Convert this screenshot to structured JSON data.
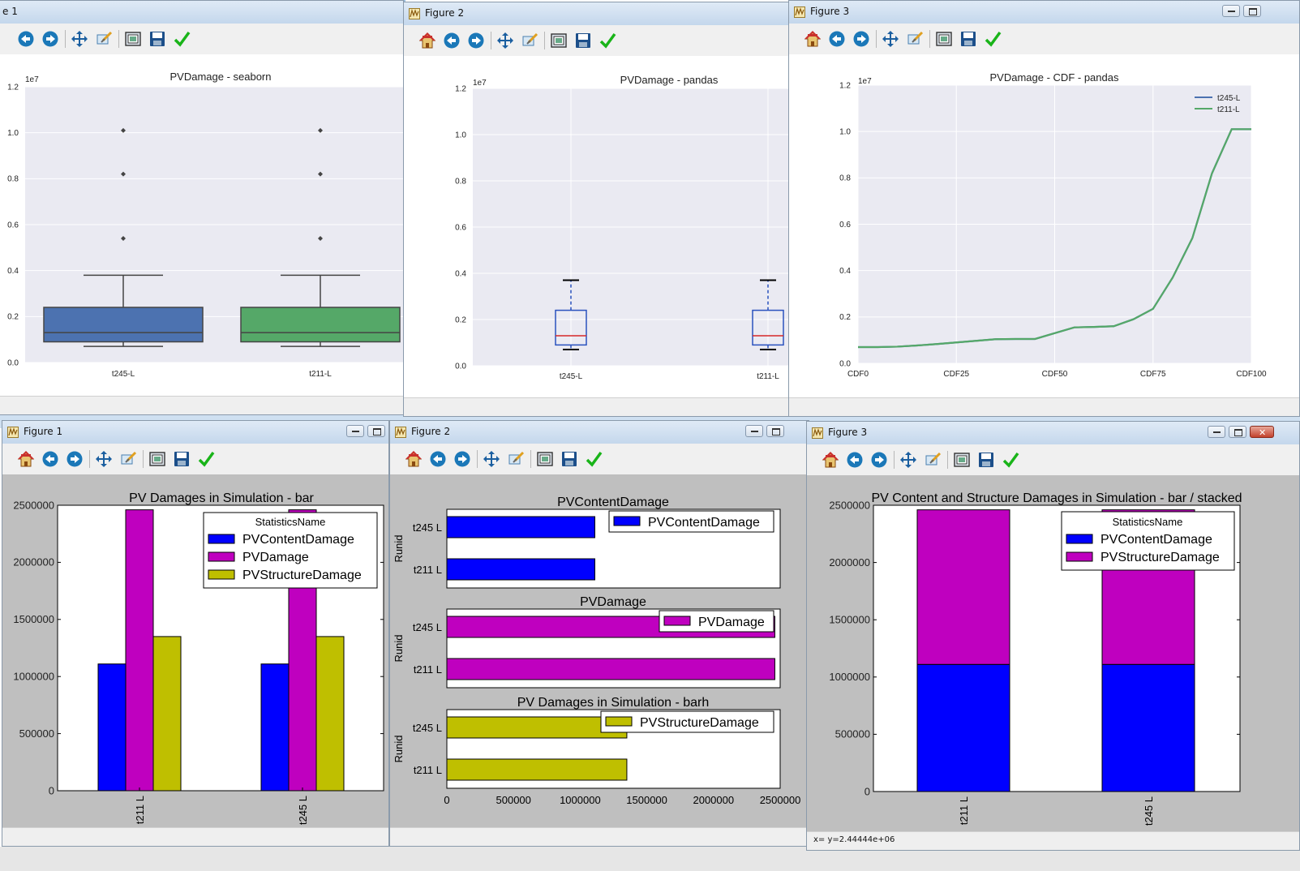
{
  "windows": [
    {
      "id": "w1",
      "title": "e 1",
      "controls": false
    },
    {
      "id": "w2",
      "title": "Figure 2",
      "controls": false
    },
    {
      "id": "w3",
      "title": "Figure 3",
      "controls": true
    },
    {
      "id": "w4",
      "title": "Figure 1",
      "controls": true
    },
    {
      "id": "w5",
      "title": "Figure 2",
      "controls": true
    },
    {
      "id": "w6",
      "title": "Figure 3",
      "controls": true,
      "close": true
    }
  ],
  "toolbar_icons": [
    "home-icon",
    "back-arrow-icon",
    "forward-arrow-icon",
    "pan-icon",
    "zoom-icon",
    "subplots-icon",
    "save-icon",
    "check-icon"
  ],
  "status": {
    "w6": "x= y=2.44444e+06"
  },
  "colors": {
    "seaborn_bg": "#eaeaf2",
    "seaborn_blue": "#4c72b0",
    "seaborn_green": "#55a868",
    "mpl_blue": "#0000ff",
    "mpl_magenta": "#bf00bf",
    "mpl_olive": "#bfbf00",
    "median_red": "#d62728",
    "gray_fig": "#bfbfbf"
  },
  "chart_data": [
    {
      "id": "c1",
      "type": "box",
      "title": "PVDamage - seaborn",
      "offset_text": "1e7",
      "ylim": [
        0,
        1.2
      ],
      "yticks": [
        "0.0",
        "0.2",
        "0.4",
        "0.6",
        "0.8",
        "1.0",
        "1.2"
      ],
      "categories": [
        "t245-L",
        "t211-L"
      ],
      "boxes": [
        {
          "name": "t245-L",
          "whislo": 0.07,
          "q1": 0.09,
          "med": 0.13,
          "q3": 0.24,
          "whishi": 0.38,
          "fliers": [
            0.54,
            0.82,
            1.01
          ]
        },
        {
          "name": "t211-L",
          "whislo": 0.07,
          "q1": 0.09,
          "med": 0.13,
          "q3": 0.24,
          "whishi": 0.38,
          "fliers": [
            0.54,
            0.82,
            1.01
          ]
        }
      ]
    },
    {
      "id": "c2",
      "type": "box",
      "title": "PVDamage - pandas",
      "offset_text": "1e7",
      "ylim": [
        0,
        1.2
      ],
      "yticks": [
        "0.0",
        "0.2",
        "0.4",
        "0.6",
        "0.8",
        "1.0",
        "1.2"
      ],
      "categories": [
        "t245-L",
        "t211-L"
      ],
      "boxes": [
        {
          "name": "t245-L",
          "whislo": 0.07,
          "q1": 0.09,
          "med": 0.13,
          "q3": 0.24,
          "whishi": 0.37
        },
        {
          "name": "t211-L",
          "whislo": 0.07,
          "q1": 0.09,
          "med": 0.13,
          "q3": 0.24,
          "whishi": 0.37
        }
      ]
    },
    {
      "id": "c3",
      "type": "line",
      "title": "PVDamage - CDF - pandas",
      "offset_text": "1e7",
      "ylim": [
        0,
        1.2
      ],
      "yticks": [
        "0.0",
        "0.2",
        "0.4",
        "0.6",
        "0.8",
        "1.0",
        "1.2"
      ],
      "xticks": [
        "CDF0",
        "CDF25",
        "CDF50",
        "CDF75",
        "CDF100"
      ],
      "x": [
        0,
        5,
        10,
        15,
        20,
        25,
        30,
        35,
        40,
        45,
        50,
        55,
        60,
        65,
        70,
        75,
        80,
        85,
        90,
        95,
        100
      ],
      "series": [
        {
          "name": "t245-L",
          "values": [
            0.07,
            0.07,
            0.072,
            0.077,
            0.083,
            0.09,
            0.097,
            0.104,
            0.105,
            0.105,
            0.13,
            0.155,
            0.157,
            0.16,
            0.19,
            0.235,
            0.37,
            0.54,
            0.82,
            1.01,
            1.01
          ]
        },
        {
          "name": "t211-L",
          "values": [
            0.07,
            0.07,
            0.072,
            0.077,
            0.083,
            0.09,
            0.097,
            0.104,
            0.105,
            0.105,
            0.13,
            0.155,
            0.157,
            0.16,
            0.19,
            0.235,
            0.37,
            0.54,
            0.82,
            1.01,
            1.01
          ]
        }
      ],
      "legend": "top-right"
    },
    {
      "id": "c4",
      "type": "bar",
      "title": "PV Damages in Simulation - bar",
      "ylim": [
        0,
        2500000
      ],
      "yticks": [
        "0",
        "500000",
        "1000000",
        "1500000",
        "2000000",
        "2500000"
      ],
      "categories": [
        "t211 L",
        "t245 L"
      ],
      "legend_title": "StatisticsName",
      "series": [
        {
          "name": "PVContentDamage",
          "values": [
            1110000,
            1110000
          ]
        },
        {
          "name": "PVDamage",
          "values": [
            2460000,
            2460000
          ]
        },
        {
          "name": "PVStructureDamage",
          "values": [
            1350000,
            1350000
          ]
        }
      ]
    },
    {
      "id": "c5",
      "type": "barh",
      "xlim": [
        0,
        2500000
      ],
      "xticks": [
        "0",
        "500000",
        "1000000",
        "1500000",
        "2000000",
        "2500000"
      ],
      "ylabel": "Runid",
      "title": "PV Damages in Simulation - barh",
      "panels": [
        {
          "title": "PVContentDamage",
          "categories": [
            "t245 L",
            "t211 L"
          ],
          "series": [
            {
              "name": "PVContentDamage",
              "values": [
                1110000,
                1110000
              ]
            }
          ]
        },
        {
          "title": "PVDamage",
          "categories": [
            "t245 L",
            "t211 L"
          ],
          "series": [
            {
              "name": "PVDamage",
              "values": [
                2460000,
                2460000
              ]
            }
          ]
        },
        {
          "title": "PV Damages in Simulation - barh",
          "categories": [
            "t245 L",
            "t211 L"
          ],
          "series": [
            {
              "name": "PVStructureDamage",
              "values": [
                1350000,
                1350000
              ]
            }
          ]
        }
      ]
    },
    {
      "id": "c6",
      "type": "bar",
      "stacked": true,
      "title": "PV Content and Structure Damages in Simulation - bar / stacked",
      "ylim": [
        0,
        2500000
      ],
      "yticks": [
        "0",
        "500000",
        "1000000",
        "1500000",
        "2000000",
        "2500000"
      ],
      "categories": [
        "t211 L",
        "t245 L"
      ],
      "legend_title": "StatisticsName",
      "series": [
        {
          "name": "PVContentDamage",
          "values": [
            1110000,
            1110000
          ]
        },
        {
          "name": "PVStructureDamage",
          "values": [
            1350000,
            1350000
          ]
        }
      ]
    }
  ]
}
